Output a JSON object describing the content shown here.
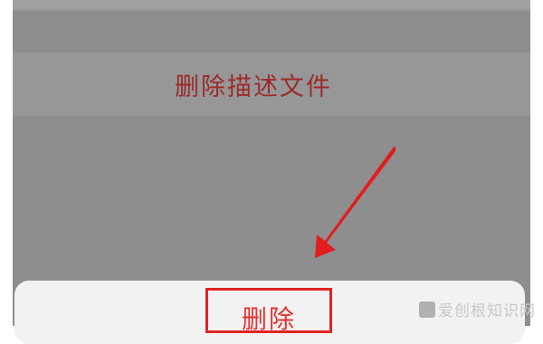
{
  "action_sheet_option": {
    "label": "删除描述文件"
  },
  "confirm_sheet": {
    "delete_label": "删除"
  },
  "watermark": {
    "text": "爱创根知识网"
  },
  "colors": {
    "overlay": "#8e8e8e",
    "option_text": "#9c2a2a",
    "highlight": "#e02424",
    "arrow": "#e11d1d"
  }
}
